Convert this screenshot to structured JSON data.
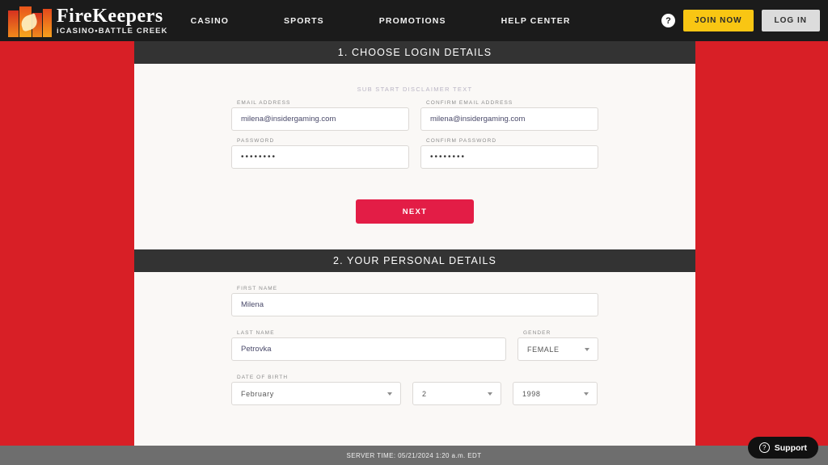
{
  "header": {
    "logo_name": "FireKeepers",
    "logo_sub": "iCASINO•BATTLE CREEK",
    "nav": [
      {
        "label": "CASINO"
      },
      {
        "label": "SPORTS"
      },
      {
        "label": "PROMOTIONS"
      },
      {
        "label": "HELP CENTER"
      }
    ],
    "help_glyph": "?",
    "join_label": "JOIN NOW",
    "login_label": "LOG IN"
  },
  "section1": {
    "title": "1. CHOOSE LOGIN DETAILS",
    "disclaimer": "SUB START DISCLAIMER TEXT",
    "fields": {
      "email_label": "EMAIL ADDRESS",
      "email_value": "milena@insidergaming.com",
      "confirm_email_label": "CONFIRM EMAIL ADDRESS",
      "confirm_email_value": "milena@insidergaming.com",
      "password_label": "PASSWORD",
      "password_value": "••••••••",
      "confirm_password_label": "CONFIRM PASSWORD",
      "confirm_password_value": "••••••••"
    },
    "next_label": "NEXT"
  },
  "section2": {
    "title": "2. YOUR PERSONAL DETAILS",
    "fields": {
      "first_name_label": "FIRST NAME",
      "first_name_value": "Milena",
      "last_name_label": "LAST NAME",
      "last_name_value": "Petrovka",
      "gender_label": "GENDER",
      "gender_value": "FEMALE",
      "dob_label": "DATE OF BIRTH",
      "dob_month": "February",
      "dob_day": "2",
      "dob_year": "1998"
    }
  },
  "footer": {
    "server_time": "SERVER TIME: 05/21/2024 1:20 a.m. EDT"
  },
  "support": {
    "icon_glyph": "?",
    "label": "Support"
  },
  "colors": {
    "page_red": "#d81f26",
    "nav_dark": "#1b1b1b",
    "section_head": "#333333",
    "join_yellow": "#f9c613",
    "next_red": "#e31d46",
    "panel_bg": "#faf8f6",
    "footer_gray": "#6e6e6e"
  }
}
